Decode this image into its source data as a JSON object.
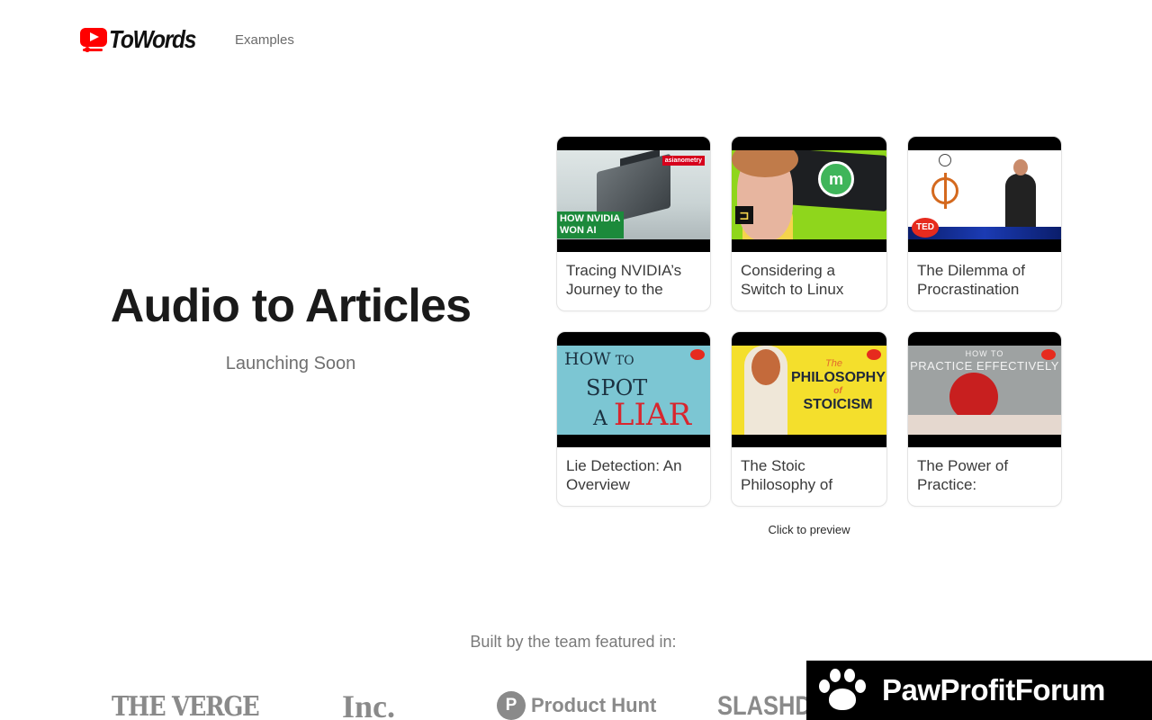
{
  "header": {
    "logo_text": "ToWords",
    "nav": {
      "examples": "Examples"
    }
  },
  "hero": {
    "title": "Audio to Articles",
    "subtitle": "Launching Soon"
  },
  "cards": [
    {
      "title": "Tracing NVIDIA’s Journey to the",
      "thumb_caption": "HOW NVIDIA WON AI",
      "thumb_badge": "asianometry"
    },
    {
      "title": "Considering a Switch to Linux",
      "thumb_caption": ""
    },
    {
      "title": "The Dilemma of Procrastination",
      "thumb_caption": "TED"
    },
    {
      "title": "Lie Detection: An Overview",
      "thumb_caption_lines": [
        "HOW",
        "TO",
        "SPOT",
        "A",
        "LIAR"
      ]
    },
    {
      "title": "The Stoic Philosophy of",
      "thumb_caption_lines": [
        "The",
        "PHILOSOPHY",
        "of",
        "STOICISM"
      ]
    },
    {
      "title": "The Power of Practice:",
      "thumb_caption_lines": [
        "HOW TO",
        "PRACTICE EFFECTIVELY"
      ]
    }
  ],
  "click_preview": "Click to preview",
  "featured": {
    "label": "Built by the team featured in:",
    "logos": [
      "THE VERGE",
      "Inc.",
      "P",
      "Product Hunt",
      "SLASHD"
    ]
  },
  "banner": {
    "text": "PawProfitForum"
  }
}
